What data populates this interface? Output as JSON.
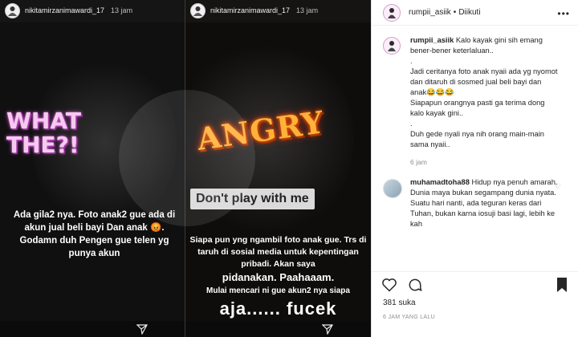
{
  "story1": {
    "username": "nikitamirzanimawardi_17",
    "time": "13 jam",
    "sticker_text": "WHAT THE?!",
    "caption": "Ada gila2 nya. Foto anak2 gue ada di akun jual beli bayi Dan anak 😡. Godamn duh Pengen gue telen yg punya akun"
  },
  "story2": {
    "username": "nikitamirzanimawardi_17",
    "time": "13 jam",
    "sticker_text": "ANGRY",
    "banner": "Don't play with me",
    "line1": "Siapa pun yng ngambil foto anak gue. Trs di taruh di sosial media untuk kepentingan pribadi. Akan saya",
    "line2": "pidanakan. Paahaaam.",
    "line3": "Mulai mencari ni gue akun2 nya siapa",
    "line4": "aja...... fucek"
  },
  "post": {
    "username": "rumpii_asiik",
    "separator": "•",
    "follow_status": "Diikuti",
    "caption_user": "rumpii_asiik",
    "caption": "Kalo kayak gini sih emang bener-bener keterlaluan..",
    "caption_p1": "Jadi ceritanya foto anak nyaii ada yg nyomot dan ditaruh di sosmed jual beli bayi dan anak😂😂😂",
    "caption_p2": "Siapapun orangnya pasti ga terima dong kalo kayak gini..",
    "caption_p3": "Duh gede nyali nya nih orang main-main sama nyaii..",
    "dot": ".",
    "caption_time": "6 jam",
    "comment_user": "muhamadtoha88",
    "comment_text": "Hidup nya penuh amarah. Dunia maya bukan segampang dunia nyata. Suatu hari nanti, ada teguran keras dari Tuhan, bukan karna iosuji basi lagi, lebih ke kah",
    "likes": "381 suka",
    "timestamp": "6 JAM YANG LALU"
  },
  "colors": {
    "story_bg": "#151515",
    "what_pink": "#f6c9f0",
    "angry_orange": "#ffb23a",
    "text_dark": "#262626",
    "text_muted": "#8e8e8e"
  },
  "icons": [
    "send-icon",
    "heart-icon",
    "comment-icon",
    "bookmark-icon",
    "more-icon"
  ]
}
